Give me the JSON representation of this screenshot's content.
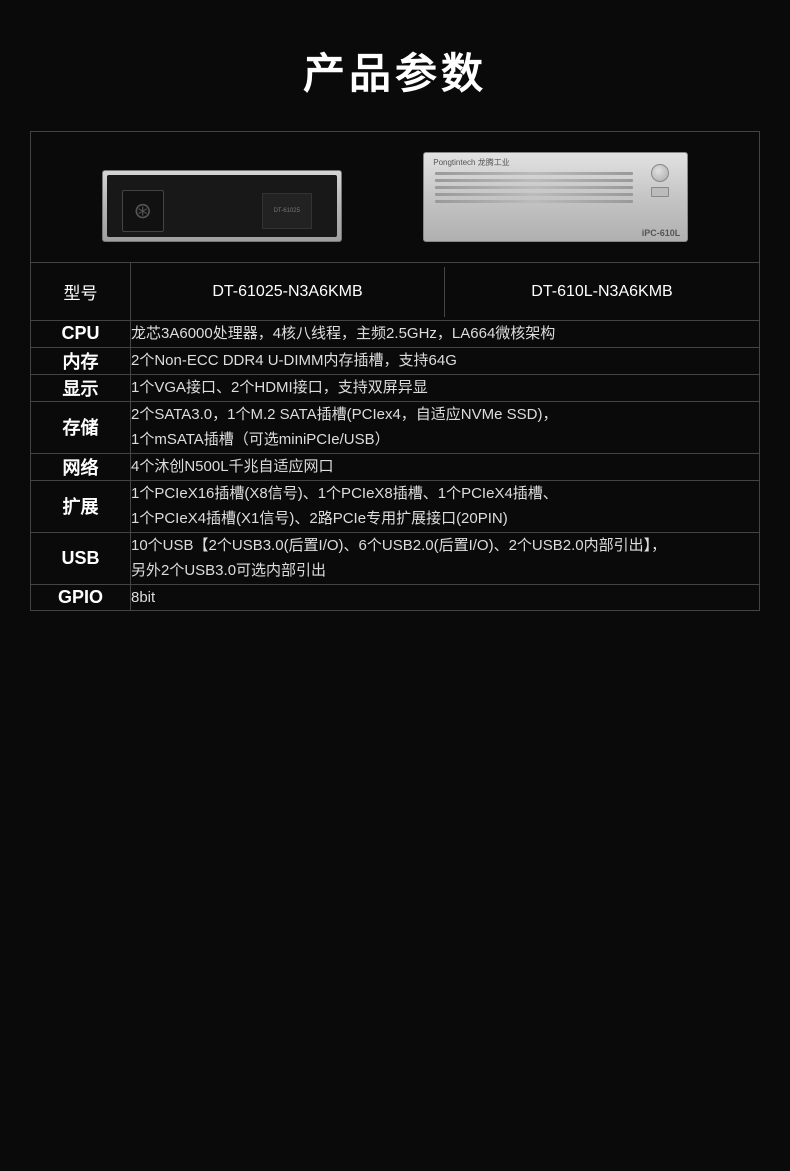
{
  "page": {
    "title": "产品参数",
    "background": "#0a0a0a"
  },
  "header": {
    "model_label": "型号",
    "model_left": "DT-61025-N3A6KMB",
    "model_right": "DT-610L-N3A6KMB"
  },
  "specs": [
    {
      "label": "CPU",
      "value": "龙芯3A6000处理器，4核八线程，主频2.5GHz，LA664微核架构"
    },
    {
      "label": "内存",
      "value": "2个Non-ECC DDR4 U-DIMM内存插槽，支持64G"
    },
    {
      "label": "显示",
      "value": "1个VGA接口、2个HDMI接口，支持双屏异显"
    },
    {
      "label": "存储",
      "value": "2个SATA3.0，1个M.2 SATA插槽(PCIex4，自适应NVMe SSD)，\n1个mSATA插槽（可选miniPCIe/USB）"
    },
    {
      "label": "网络",
      "value": "4个沐创N500L千兆自适应网口"
    },
    {
      "label": "扩展",
      "value": "1个PCIeX16插槽(X8信号)、1个PCIeX8插槽、1个PCIeX4插槽、\n1个PCIeX4插槽(X1信号)、2路PCIe专用扩展接口(20PIN)"
    },
    {
      "label": "USB",
      "value": "10个USB【2个USB3.0(后置I/O)、6个USB2.0(后置I/O)、2个USB2.0内部引出】，\n另外2个USB3.0可选内部引出"
    },
    {
      "label": "GPIO",
      "value": "8bit"
    }
  ],
  "product_images": {
    "left_alt": "DT-61025 2U服务器",
    "right_alt": "DT-610L IPC工控机",
    "right_label": "iPC-610L",
    "right_brand": "Pongtintech 龙腾工业"
  }
}
